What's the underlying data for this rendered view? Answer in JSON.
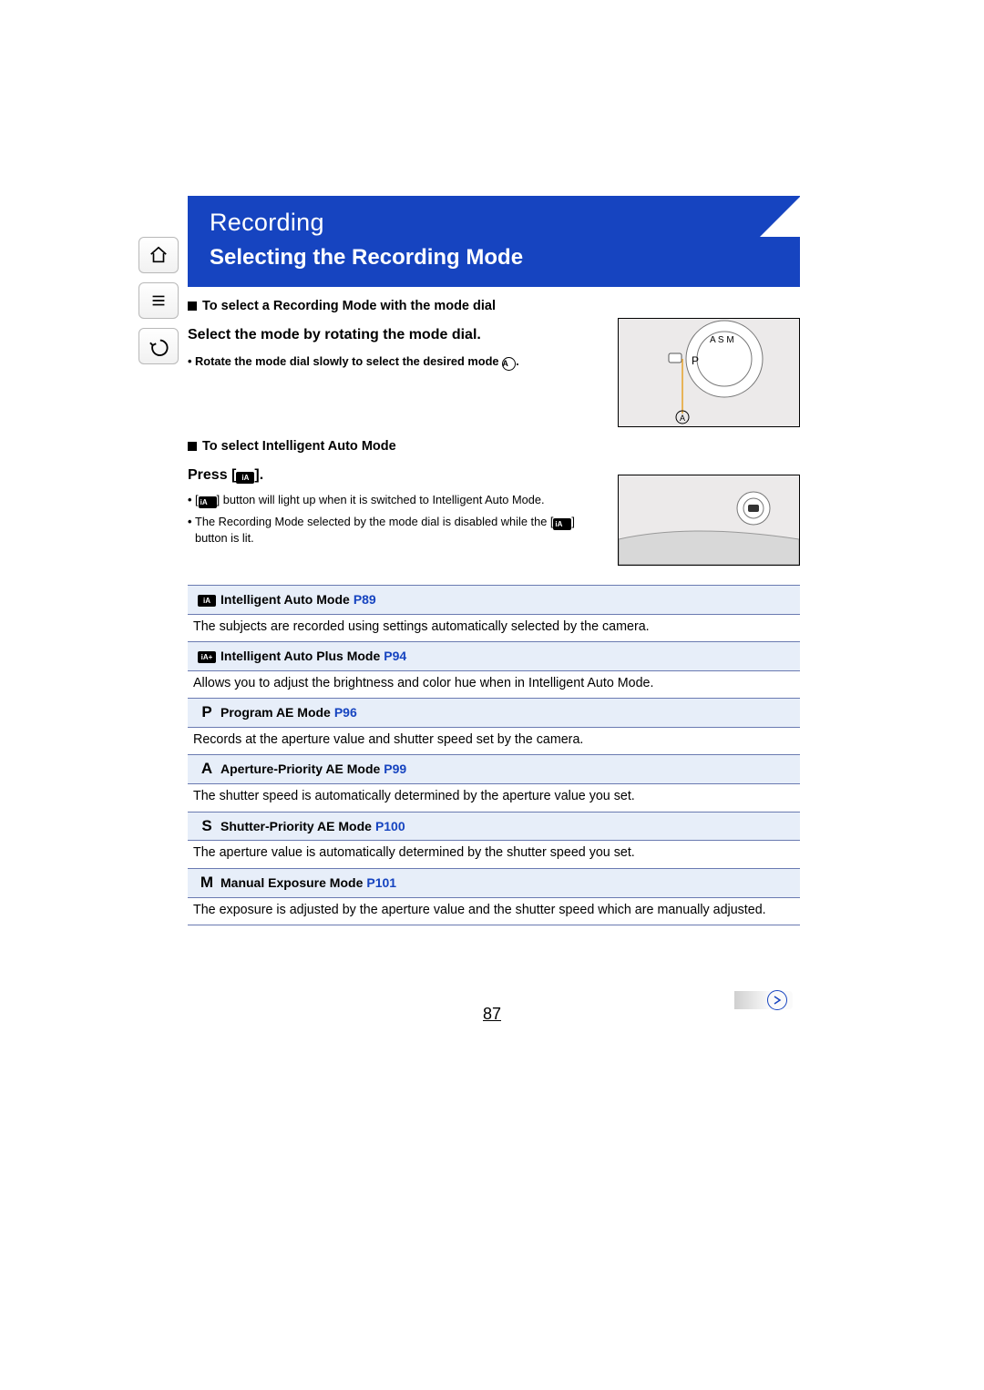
{
  "nav": {
    "home": "Home",
    "toc": "Table of contents",
    "back": "Back"
  },
  "header": {
    "breadcrumb": "Recording",
    "title": "Selecting the Recording Mode"
  },
  "section1": {
    "heading": "To select a Recording Mode with the mode dial",
    "instruction": "Select the mode by rotating the mode dial.",
    "note": "Rotate the mode dial slowly to select the desired mode ",
    "note_marker": "A",
    "note_suffix": "."
  },
  "section2": {
    "heading": "To select Intelligent Auto Mode",
    "press_prefix": "Press [",
    "press_icon": "iA",
    "press_suffix": "].",
    "bullet1_a": "[",
    "bullet1_b": "iA",
    "bullet1_c": "] button will light up when it is switched to Intelligent Auto Mode.",
    "bullet2_a": "The Recording Mode selected by the mode dial is disabled while the [",
    "bullet2_b": "iA",
    "bullet2_c": "] button is lit."
  },
  "modes": [
    {
      "symbol_type": "ia",
      "symbol": "iA",
      "name": "Intelligent Auto Mode",
      "page": "P89",
      "desc": "The subjects are recorded using settings automatically selected by the camera."
    },
    {
      "symbol_type": "ia",
      "symbol": "iA+",
      "name": "Intelligent Auto Plus Mode",
      "page": "P94",
      "desc": "Allows you to adjust the brightness and color hue when in Intelligent Auto Mode."
    },
    {
      "symbol_type": "letter",
      "symbol": "P",
      "name": "Program AE Mode",
      "page": "P96",
      "desc": "Records at the aperture value and shutter speed set by the camera."
    },
    {
      "symbol_type": "letter",
      "symbol": "A",
      "name": "Aperture-Priority AE Mode",
      "page": "P99",
      "desc": "The shutter speed is automatically determined by the aperture value you set."
    },
    {
      "symbol_type": "letter",
      "symbol": "S",
      "name": "Shutter-Priority AE Mode",
      "page": "P100",
      "desc": "The aperture value is automatically determined by the shutter speed you set."
    },
    {
      "symbol_type": "letter",
      "symbol": "M",
      "name": "Manual Exposure Mode",
      "page": "P101",
      "desc": "The exposure is adjusted by the aperture value and the shutter speed which are manually adjusted."
    }
  ],
  "page_number": "87",
  "colors": {
    "accent": "#1644c0",
    "row_bg": "#e7eef9"
  }
}
